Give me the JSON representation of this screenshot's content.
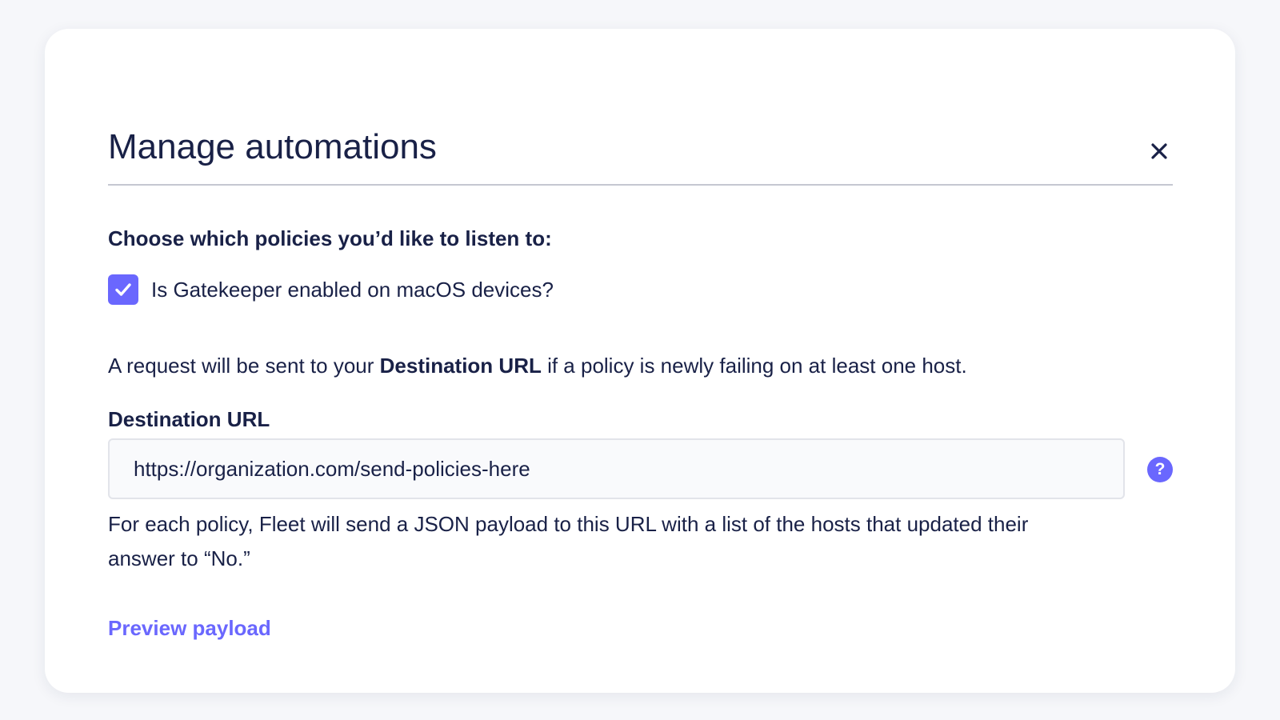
{
  "modal": {
    "title": "Manage automations",
    "close_icon": "close-icon"
  },
  "policies": {
    "heading": "Choose which policies you’d like to listen to:",
    "items": [
      {
        "label": "Is Gatekeeper enabled on macOS devices?",
        "checked": true
      }
    ]
  },
  "request_info": {
    "prefix": "A request will be sent to your ",
    "emphasis": "Destination URL",
    "suffix": " if a policy is newly failing on at least one host."
  },
  "destination": {
    "label": "Destination URL",
    "placeholder": "https://organization.com/send-policies-here",
    "value": "",
    "help_icon": "help-icon",
    "help_icon_glyph": "?",
    "help_text": "For each policy, Fleet will send a JSON payload to this URL with a list of the hosts that updated their answer to “No.”"
  },
  "preview_link": "Preview payload",
  "colors": {
    "accent": "#6a67fe",
    "text": "#192147",
    "divider": "#c5c7d1",
    "input_bg": "#f9fafc",
    "input_border": "#e2e4ea"
  }
}
